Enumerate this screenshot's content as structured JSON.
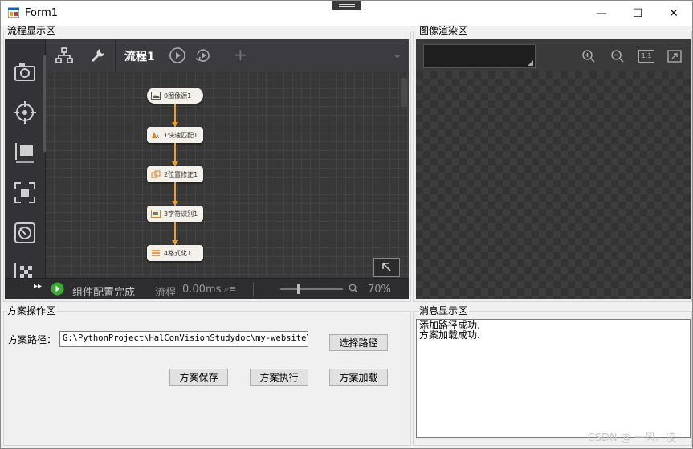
{
  "window": {
    "title": "Form1",
    "minimize": "—",
    "maximize": "☐",
    "close": "✕"
  },
  "flow_group": {
    "label": "流程显示区"
  },
  "flow_editor": {
    "tab_title": "流程1",
    "add_icon": "+",
    "dropdown_icon": "⌄",
    "nodes": [
      "0图像源1",
      "1快速匹配1",
      "2位置修正1",
      "3字符识别1",
      "4格式化1"
    ],
    "status": {
      "message": "组件配置完成",
      "flow_label": "流程",
      "time": "0.00ms",
      "zoom": "70%"
    },
    "zoom_level": 0.3
  },
  "render_group": {
    "label": "图像渲染区",
    "ratio_label": "1:1"
  },
  "scheme_group": {
    "label": "方案操作区",
    "path_label": "方案路径：",
    "path_value": "G:\\PythonProject\\HalConVisionStudydoc\\my-website\\do",
    "choose_path": "选择路径",
    "save": "方案保存",
    "run": "方案执行",
    "load": "方案加载"
  },
  "message_group": {
    "label": "消息显示区",
    "lines": [
      "添加路径成功.",
      "方案加载成功."
    ]
  },
  "watermark": "CSDN @ 一风、凌"
}
